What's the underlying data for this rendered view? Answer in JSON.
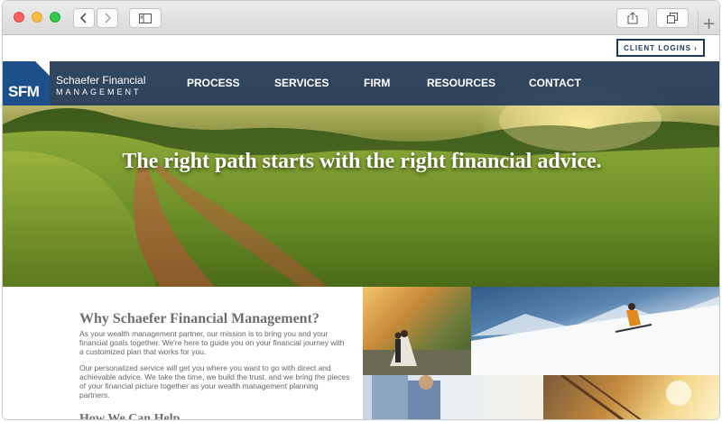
{
  "nav": {
    "client_logins": "CLIENT LOGINS ›",
    "brand": {
      "mark": "SFM",
      "name": "Schaefer Financial",
      "subtitle": "MANAGEMENT"
    },
    "items": [
      "PROCESS",
      "SERVICES",
      "FIRM",
      "RESOURCES",
      "CONTACT"
    ]
  },
  "hero": {
    "tagline": "The right path starts with the right financial advice."
  },
  "intro": {
    "heading": "Why Schaefer Financial Management?",
    "para1": "As your wealth management partner, our mission is to bring you and your financial goals together. We're here to guide you on your financial journey with a customized plan that works for you.",
    "para2": "Our personalized service will get you where you want to go with direct and achievable advice. We take the time, we build the trust, and we bring the pieces of your financial picture together as your wealth management planning partners.",
    "next_heading": "How We Can Help"
  },
  "colors": {
    "navy": "#1e3a5f",
    "logo_blue": "#1d4f8a"
  }
}
